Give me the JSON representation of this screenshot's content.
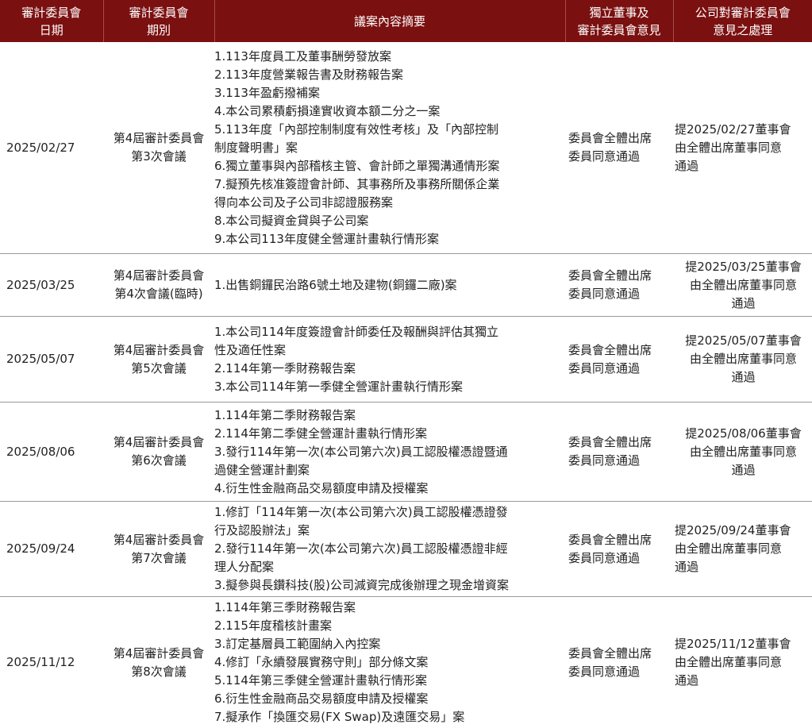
{
  "header": {
    "date": "審計委員會\n日期",
    "session": "審計委員會\n期別",
    "content": "議案內容摘要",
    "opinion": "獨立董事及\n審計委員會意見",
    "handling": "公司對審計委員會\n意見之處理"
  },
  "rows": [
    {
      "date": "2025/02/27",
      "session": "第4屆審計委員會\n第3次會議",
      "items": [
        "1.113年度員工及董事酬勞發放案",
        "2.113年度營業報告書及財務報告案",
        "3.113年盈虧撥補案",
        "4.本公司累積虧損達實收資本額二分之一案",
        "5.113年度「內部控制制度有效性考核」及「內部控制",
        "制度聲明書」案",
        "6.獨立董事與內部稽核主管、會計師之單獨溝通情形案",
        "7.擬預先核准簽證會計師、其事務所及事務所關係企業",
        "得向本公司及子公司非認證服務案",
        "8.本公司擬資金貸與子公司案",
        "9.本公司113年度健全營運計畫執行情形案"
      ],
      "opinion": "委員會全體出席\n委員同意通過",
      "handling": "提2025/02/27董事會\n由全體出席董事同意\n通過"
    },
    {
      "date": "2025/03/25",
      "session": "第4屆審計委員會\n第4次會議(臨時)",
      "items": [
        "1.出售銅鑼民治路6號土地及建物(銅鑼二廠)案"
      ],
      "opinion": "委員會全體出席\n委員同意通過",
      "handling": "提2025/03/25董事會\n由全體出席董事同意\n通過"
    },
    {
      "date": "2025/05/07",
      "session": "第4屆審計委員會\n第5次會議",
      "items": [
        "1.本公司114年度簽證會計師委任及報酬與評估其獨立",
        "性及適任性案",
        "2.114年第一季財務報告案",
        "3.本公司114年第一季健全營運計畫執行情形案"
      ],
      "opinion": "委員會全體出席\n委員同意通過",
      "handling": "提2025/05/07董事會\n由全體出席董事同意\n通過"
    },
    {
      "date": "2025/08/06",
      "session": "第4屆審計委員會\n第6次會議",
      "items": [
        "1.114年第二季財務報告案",
        "2.114年第二季健全營運計畫執行情形案",
        "3.發行114年第一次(本公司第六次)員工認股權憑證暨通",
        "過健全營運計劃案",
        "4.衍生性金融商品交易額度申請及授權案"
      ],
      "opinion": "委員會全體出席\n委員同意通過",
      "handling": "提2025/08/06董事會\n由全體出席董事同意\n通過"
    },
    {
      "date": "2025/09/24",
      "session": "第4屆審計委員會\n第7次會議",
      "items": [
        "1.修訂「114年第一次(本公司第六次)員工認股權憑證發",
        "行及認股辦法」案",
        "2.發行114年第一次(本公司第六次)員工認股權憑證非經",
        "理人分配案",
        "3.擬參與長鑽科技(股)公司減資完成後辦理之現金增資案"
      ],
      "opinion": "委員會全體出席\n委員同意通過",
      "handling": "提2025/09/24董事會\n由全體出席董事同意\n通過"
    },
    {
      "date": "2025/11/12",
      "session": "第4屆審計委員會\n第8次會議",
      "items": [
        "1.114年第三季財務報告案",
        "2.115年度稽核計畫案",
        "3.訂定基層員工範圍納入內控案",
        "4.修訂「永續發展實務守則」部分條文案",
        "5.114年第三季健全營運計畫執行情形案",
        "6.衍生性金融商品交易額度申請及授權案",
        "7.擬承作「換匯交易(FX Swap)及遠匯交易」案"
      ],
      "opinion": "委員會全體出席\n委員同意通過",
      "handling": "提2025/11/12董事會\n由全體出席董事同意\n通過"
    }
  ]
}
